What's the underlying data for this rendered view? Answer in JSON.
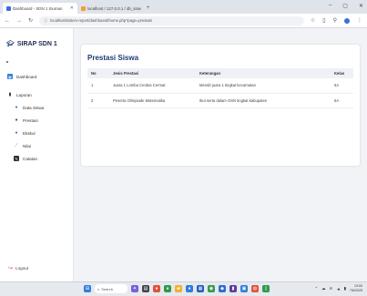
{
  "browser": {
    "tabs": [
      {
        "label": "Dashboard - SDN 1 Siuman",
        "active": true
      },
      {
        "label": "localhost / 127.0.0.1 / db_sisw",
        "active": false
      }
    ],
    "new_tab_icon": "plus-icon",
    "url": "localhost/sistem-report/dashboard/home.php?page=prestasi",
    "window_controls": [
      "minimize-icon",
      "maximize-icon",
      "close-icon"
    ]
  },
  "sidebar": {
    "brand": "SIRAP SDN 1",
    "items": [
      {
        "label": "Dashboard",
        "icon": "dashboard-icon",
        "sub": false
      },
      {
        "label": "Laporan",
        "icon": "document-icon",
        "sub": false
      },
      {
        "label": "Data Siswa",
        "icon": "user-icon",
        "sub": true
      },
      {
        "label": "Prestasi",
        "icon": "trophy-icon",
        "sub": true
      },
      {
        "label": "Ekskul",
        "icon": "globe-icon",
        "sub": true
      },
      {
        "label": "Nilai",
        "icon": "chart-line-icon",
        "sub": true
      },
      {
        "label": "Catatan",
        "icon": "note-icon",
        "sub": true
      }
    ],
    "logout": "Logout"
  },
  "main": {
    "title": "Prestasi Siswa",
    "table": {
      "headers": [
        "No",
        "Jenis Prestasi",
        "Keterangan",
        "Kelas"
      ],
      "rows": [
        [
          "1",
          "Juara 1 Lomba Cerdas Cermat",
          "Meraih juara 1 tingkat kecamatan",
          "5A"
        ],
        [
          "2",
          "Peserta Olimpiade Matematika",
          "Ikut serta dalam OSN tingkat kabupaten",
          "5A"
        ]
      ]
    }
  },
  "taskbar": {
    "search_placeholder": "Search",
    "clock_time": "13:00",
    "clock_date": "7/6/2025"
  },
  "colors": {
    "accent": "#1d3a73",
    "sidebar_bg": "#ffffff",
    "page_bg": "#f1f3f6"
  }
}
